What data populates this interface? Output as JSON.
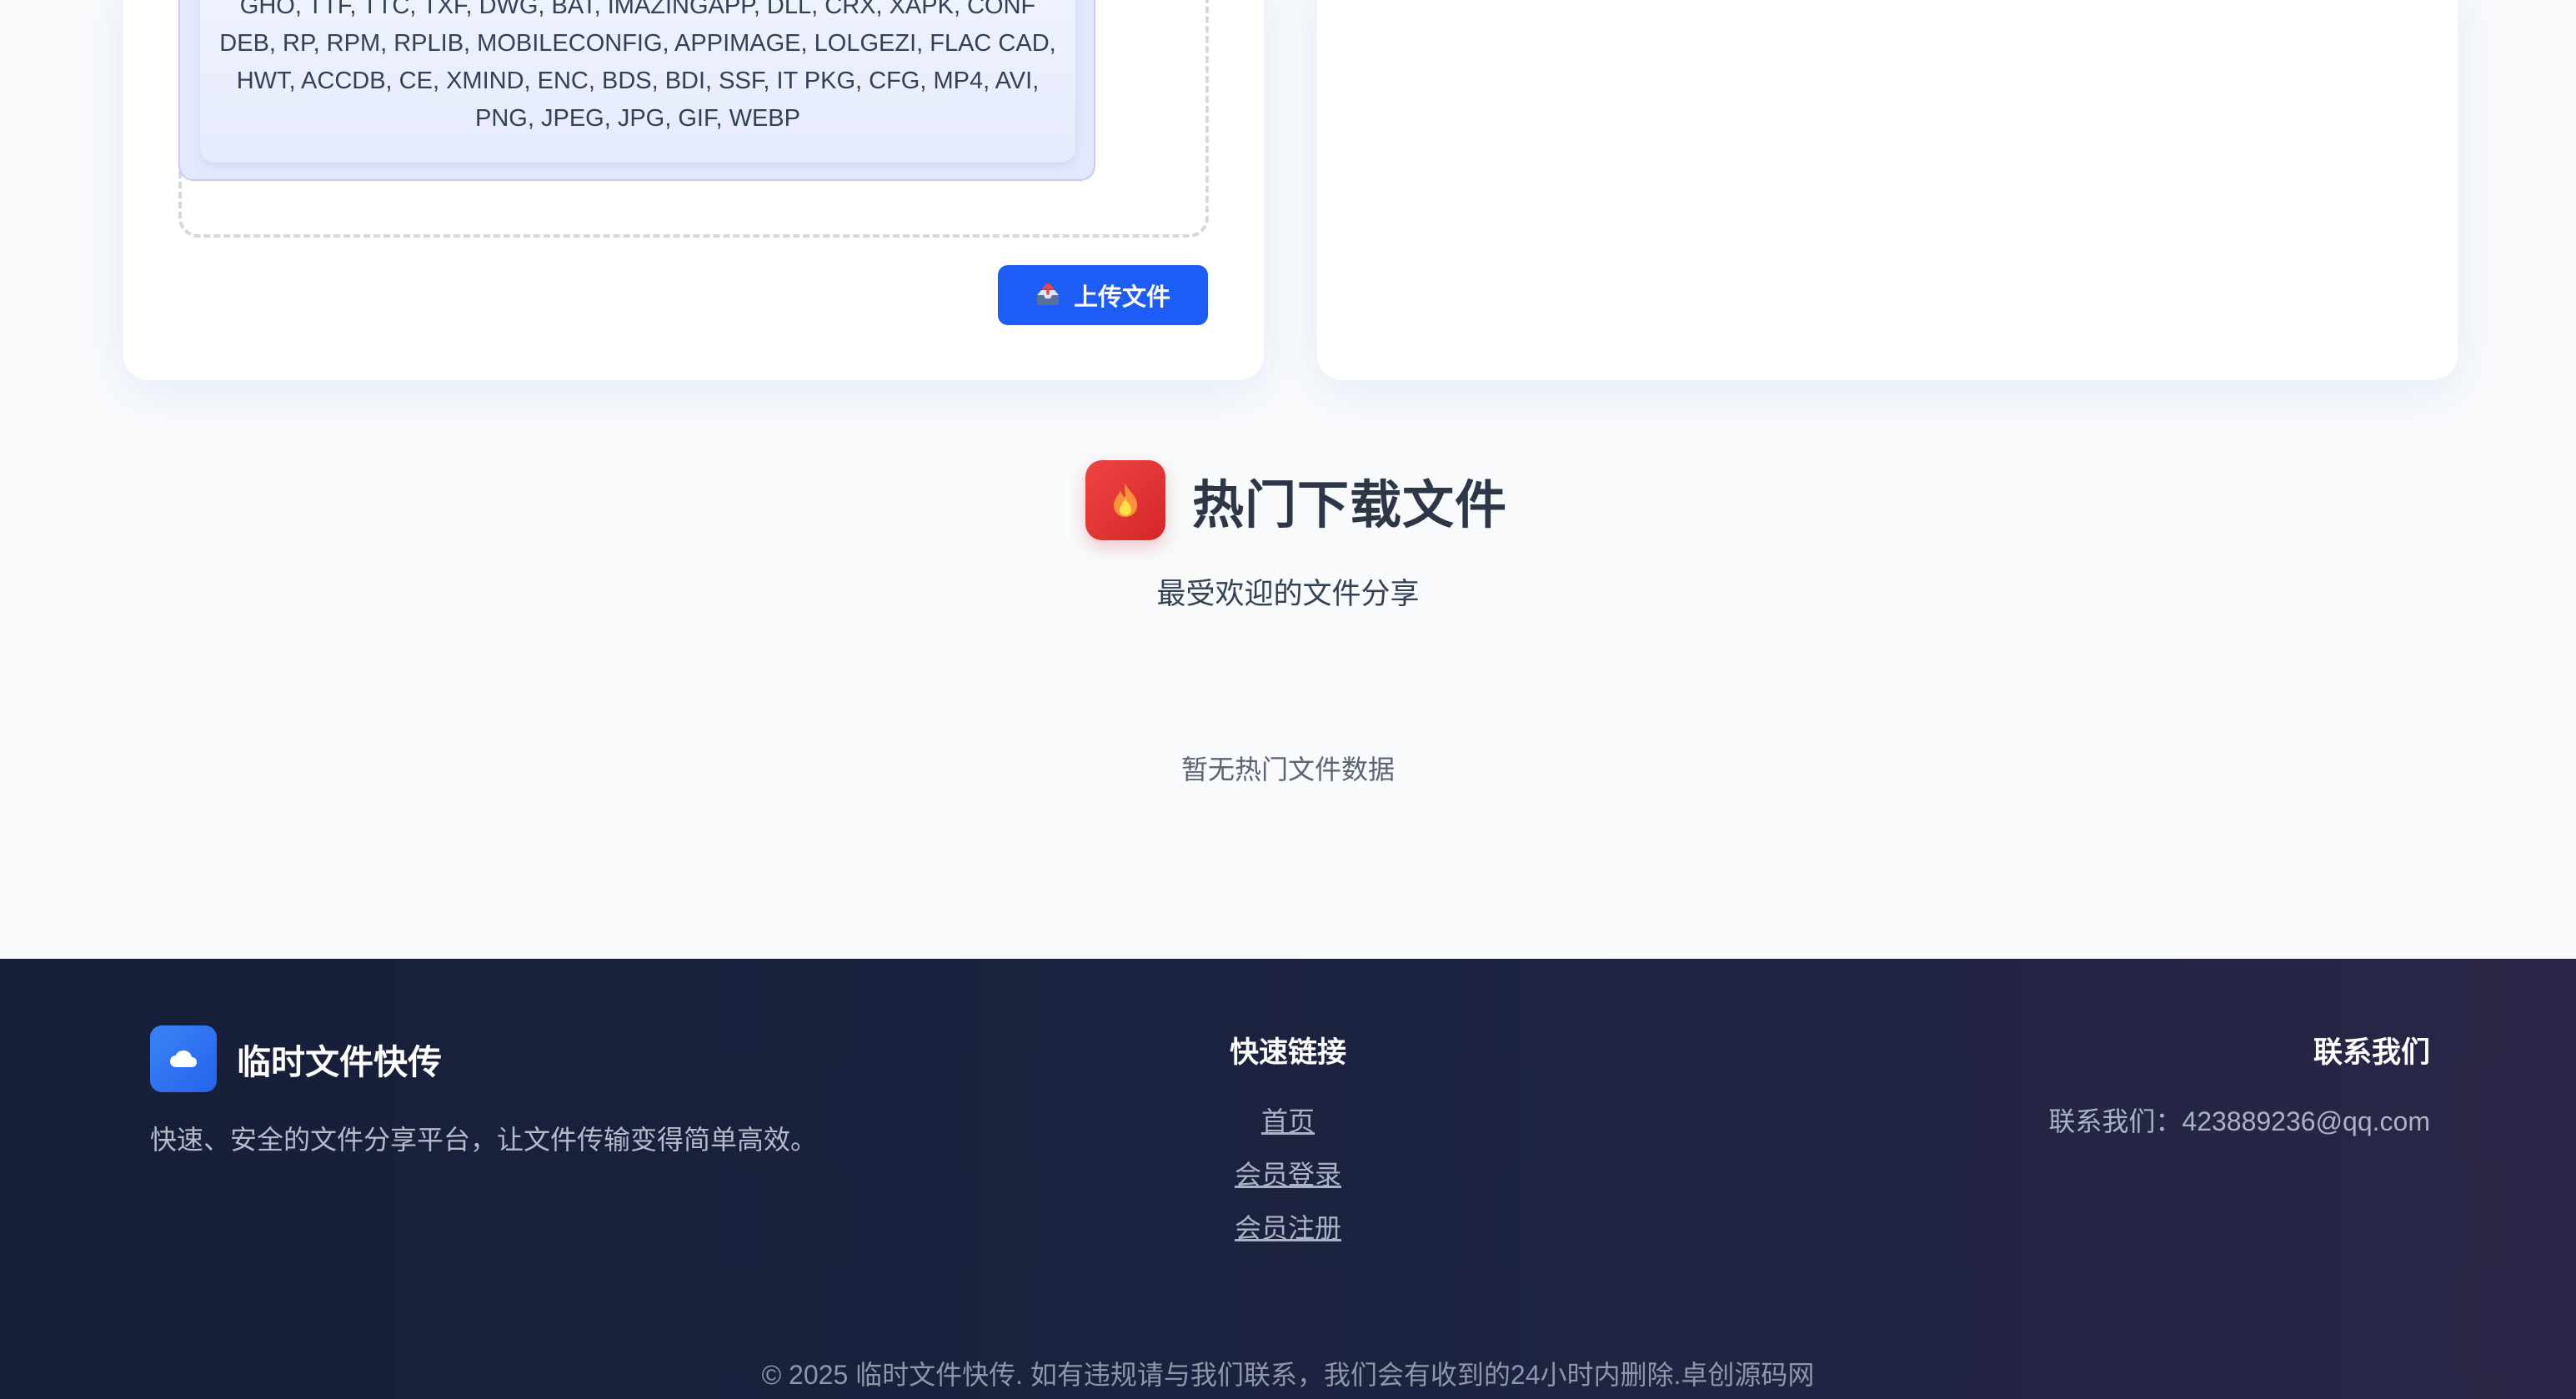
{
  "upload": {
    "formats_lines": [
      "GHO, TTF, TTC, TXF, DWG, BAT, IMAZINGAPP, DLL, CRX, XAPK, CONF",
      "DEB, RP, RPM, RPLIB, MOBILECONFIG, APPIMAGE, LOLGEZI, FLAC CAD,",
      "HWT, ACCDB, CE, XMIND, ENC, BDS, BDI, SSF, IT PKG, CFG, MP4, AVI,",
      "PNG, JPEG, JPG, GIF, WEBP"
    ],
    "button_label": "上传文件",
    "button_icon": "inbox-upload-icon"
  },
  "hot": {
    "icon": "fire-icon",
    "title": "热门下载文件",
    "subtitle": "最受欢迎的文件分享",
    "empty_text": "暂无热门文件数据"
  },
  "footer": {
    "brand_icon": "cloud-icon",
    "brand_name": "临时文件快传",
    "brand_desc": "快速、安全的文件分享平台，让文件传输变得简单高效。",
    "links_title": "快速链接",
    "links": [
      "首页",
      "会员登录",
      "会员注册"
    ],
    "contact_title": "联系我们",
    "contact_info": "联系我们：423889236@qq.com",
    "copyright": "© 2025 临时文件快传. 如有违规请与我们联系，我们会有收到的24小时内删除.卓创源码网"
  },
  "colors": {
    "primary": "#1d5cf5",
    "hot": "#e53535",
    "footer_bg": "#1c2341"
  }
}
